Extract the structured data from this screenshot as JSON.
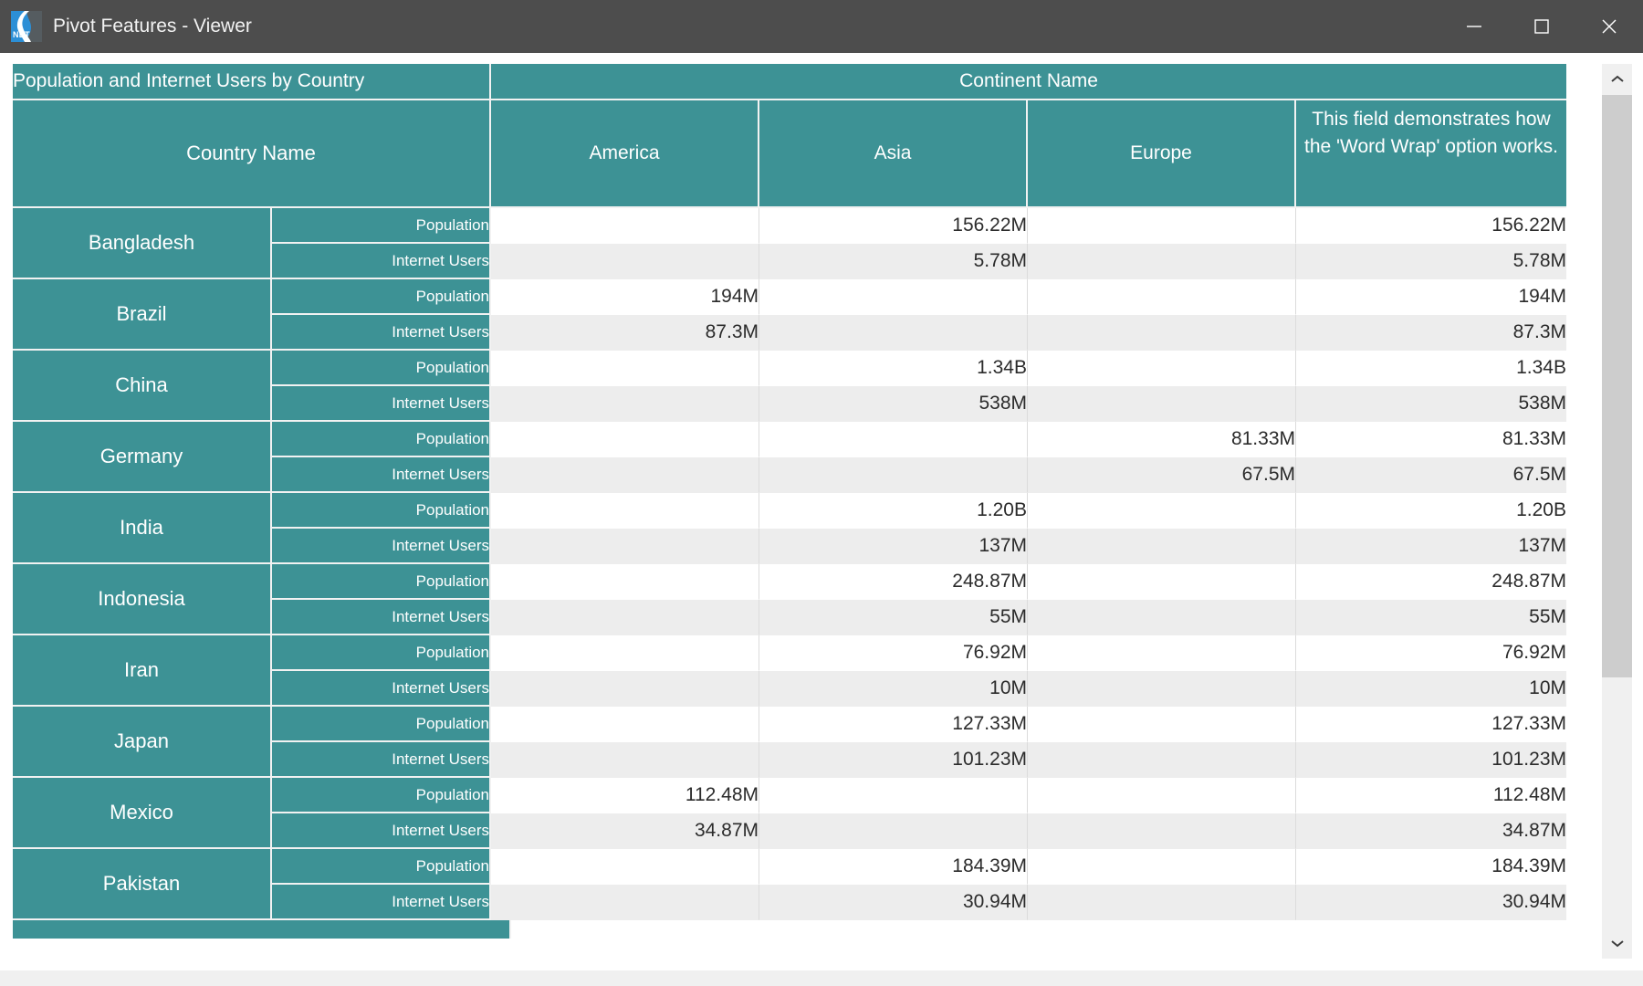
{
  "window": {
    "title": "Pivot Features - Viewer",
    "icon_name": "dotnet-logo-icon",
    "icon_tag": "NET",
    "minimize_label": "Minimize",
    "maximize_label": "Maximize",
    "close_label": "Close"
  },
  "colors": {
    "titlebar": "#4d4d4d",
    "header_teal": "#3d9295",
    "row_alt": "#ededed",
    "row_base": "#ffffff",
    "text_dark": "#2b2b2b",
    "scroll_thumb": "#cdcdcd",
    "icon_blue": "#2c8fd6"
  },
  "grid": {
    "corner_title": "Population and Internet Users by Country",
    "row_field_header": "Country Name",
    "column_field_header": "Continent Name",
    "columns": [
      "America",
      "Asia",
      "Europe",
      "This field demonstrates how the 'Word Wrap' option works."
    ],
    "measures": [
      "Population",
      "Internet Users"
    ],
    "rows": [
      {
        "country": "Bangladesh",
        "values": [
          [
            "",
            "156.22M",
            "",
            "156.22M"
          ],
          [
            "",
            "5.78M",
            "",
            "5.78M"
          ]
        ]
      },
      {
        "country": "Brazil",
        "values": [
          [
            "194M",
            "",
            "",
            "194M"
          ],
          [
            "87.3M",
            "",
            "",
            "87.3M"
          ]
        ]
      },
      {
        "country": "China",
        "values": [
          [
            "",
            "1.34B",
            "",
            "1.34B"
          ],
          [
            "",
            "538M",
            "",
            "538M"
          ]
        ]
      },
      {
        "country": "Germany",
        "values": [
          [
            "",
            "",
            "81.33M",
            "81.33M"
          ],
          [
            "",
            "",
            "67.5M",
            "67.5M"
          ]
        ]
      },
      {
        "country": "India",
        "values": [
          [
            "",
            "1.20B",
            "",
            "1.20B"
          ],
          [
            "",
            "137M",
            "",
            "137M"
          ]
        ]
      },
      {
        "country": "Indonesia",
        "values": [
          [
            "",
            "248.87M",
            "",
            "248.87M"
          ],
          [
            "",
            "55M",
            "",
            "55M"
          ]
        ]
      },
      {
        "country": "Iran",
        "values": [
          [
            "",
            "76.92M",
            "",
            "76.92M"
          ],
          [
            "",
            "10M",
            "",
            "10M"
          ]
        ]
      },
      {
        "country": "Japan",
        "values": [
          [
            "",
            "127.33M",
            "",
            "127.33M"
          ],
          [
            "",
            "101.23M",
            "",
            "101.23M"
          ]
        ]
      },
      {
        "country": "Mexico",
        "values": [
          [
            "112.48M",
            "",
            "",
            "112.48M"
          ],
          [
            "34.87M",
            "",
            "",
            "34.87M"
          ]
        ]
      },
      {
        "country": "Pakistan",
        "values": [
          [
            "",
            "184.39M",
            "",
            "184.39M"
          ],
          [
            "",
            "30.94M",
            "",
            "30.94M"
          ]
        ]
      }
    ]
  },
  "scrollbar": {
    "up_arrow_icon": "chevron-up-icon",
    "down_arrow_icon": "chevron-down-icon"
  }
}
